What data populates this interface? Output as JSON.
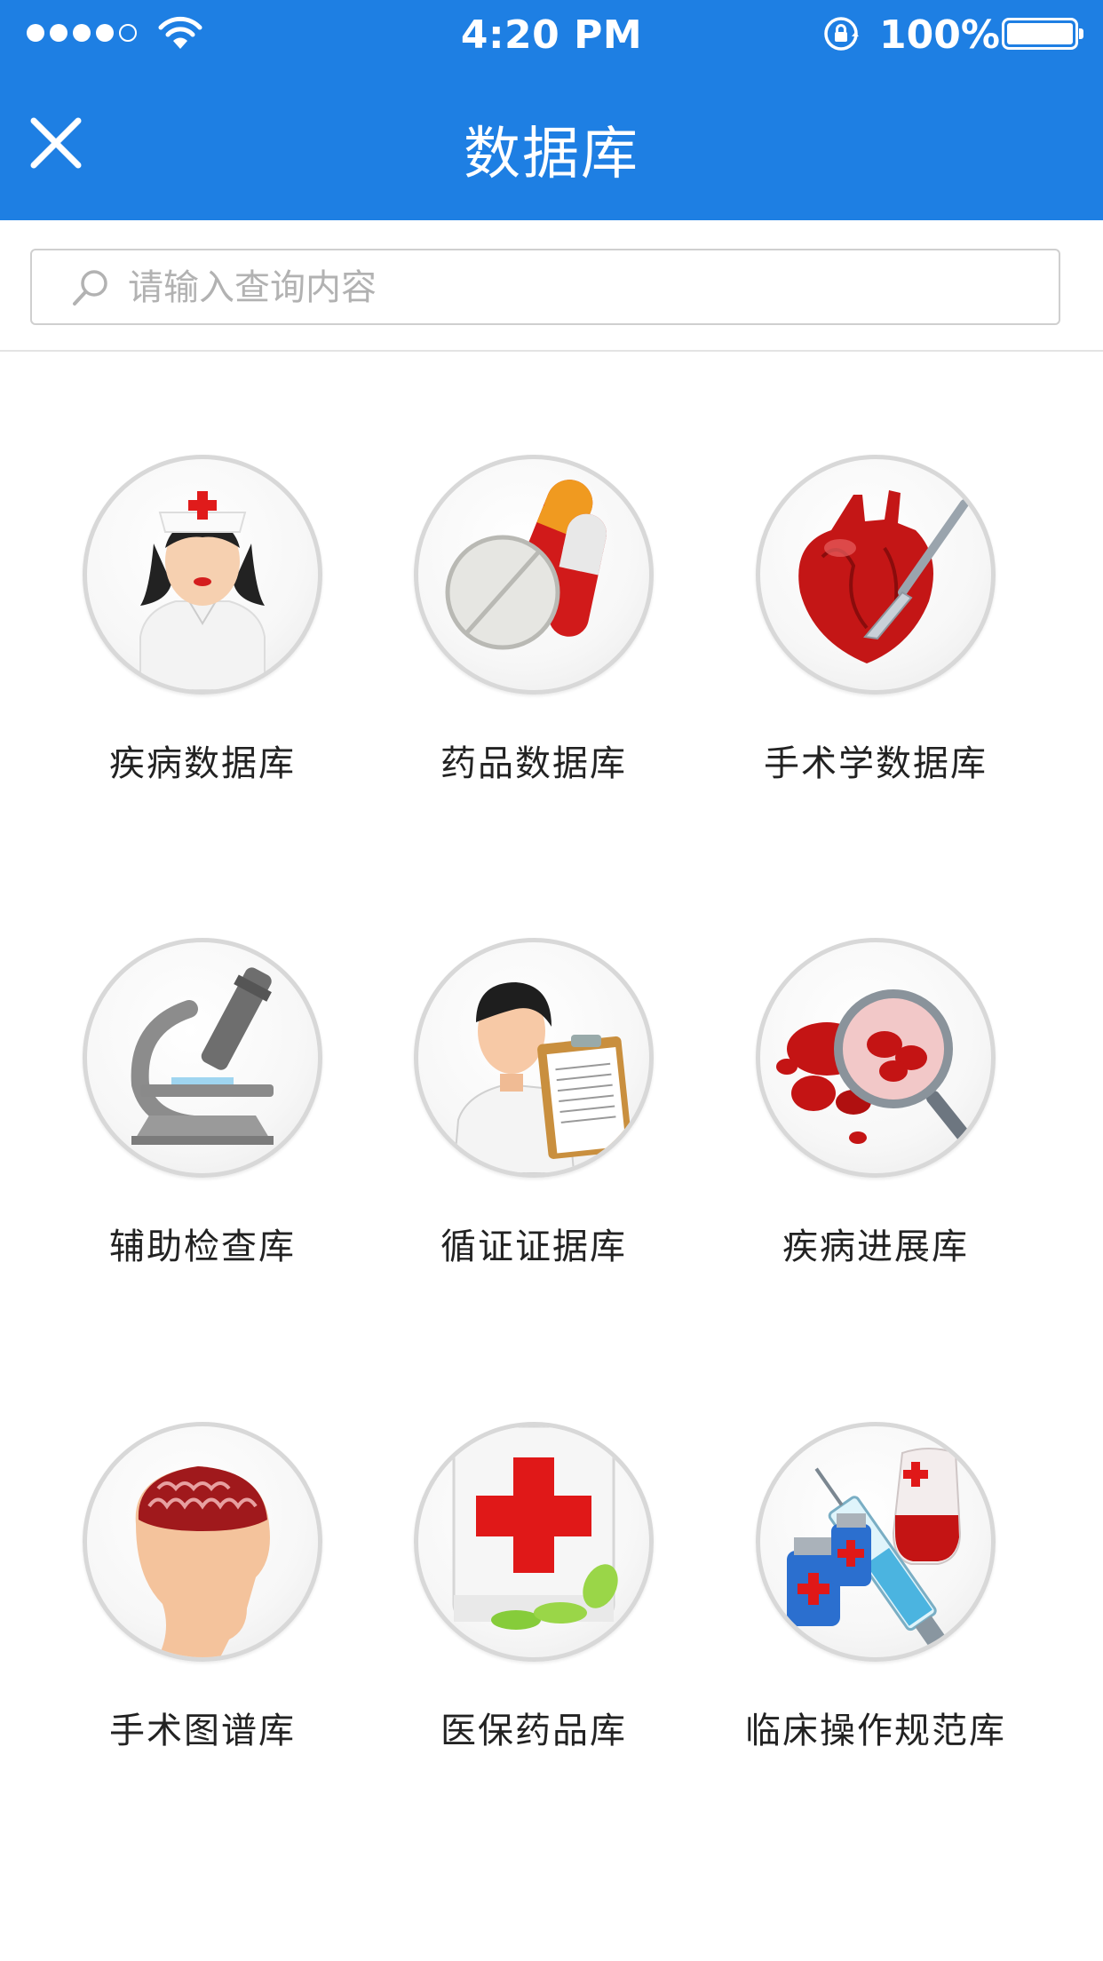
{
  "status_bar": {
    "time": "4:20 PM",
    "battery_percent": "100%",
    "signal_bars": 4,
    "signal_total": 5,
    "icons": [
      "signal-dots",
      "wifi-icon",
      "rotation-lock-icon",
      "battery-icon"
    ]
  },
  "nav": {
    "title": "数据库",
    "close_icon": "close-icon"
  },
  "search": {
    "placeholder": "请输入查询内容",
    "icon": "search-icon"
  },
  "databases": [
    {
      "label": "疾病数据库",
      "icon": "nurse-icon"
    },
    {
      "label": "药品数据库",
      "icon": "pills-icon"
    },
    {
      "label": "手术学数据库",
      "icon": "heart-scalpel-icon"
    },
    {
      "label": "辅助检查库",
      "icon": "microscope-icon"
    },
    {
      "label": "循证证据库",
      "icon": "doctor-clipboard-icon"
    },
    {
      "label": "疾病进展库",
      "icon": "blood-magnifier-icon"
    },
    {
      "label": "手术图谱库",
      "icon": "brain-head-icon"
    },
    {
      "label": "医保药品库",
      "icon": "medkit-icon"
    },
    {
      "label": "临床操作规范库",
      "icon": "syringe-vials-icon"
    }
  ],
  "colors": {
    "header_blue": "#1e7fe3",
    "text_dark": "#222222",
    "placeholder_gray": "#b2b2b2"
  }
}
